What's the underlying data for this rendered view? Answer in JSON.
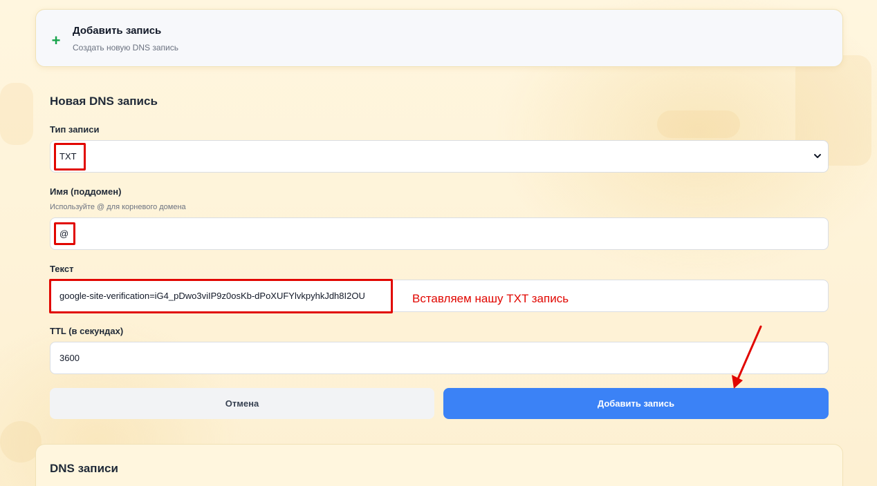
{
  "add_card": {
    "title": "Добавить запись",
    "subtitle": "Создать новую DNS запись",
    "icon": "plus-icon"
  },
  "form": {
    "title": "Новая DNS запись",
    "type": {
      "label": "Тип записи",
      "value": "TXT"
    },
    "name": {
      "label": "Имя (поддомен)",
      "hint": "Используйте @ для корневого домена",
      "value": "@"
    },
    "text": {
      "label": "Текст",
      "value": "google-site-verification=iG4_pDwo3viIP9z0osKb-dPoXUFYlvkpyhkJdh8I2OU"
    },
    "ttl": {
      "label": "TTL (в секундах)",
      "value": "3600"
    },
    "cancel_label": "Отмена",
    "submit_label": "Добавить запись"
  },
  "annotation": {
    "text": "Вставляем нашу TXT запись",
    "color": "#e10600"
  },
  "dns_list": {
    "title": "DNS записи"
  },
  "colors": {
    "accent": "#3b82f6",
    "plus": "#16a34a",
    "background": "#fdf3d8"
  }
}
